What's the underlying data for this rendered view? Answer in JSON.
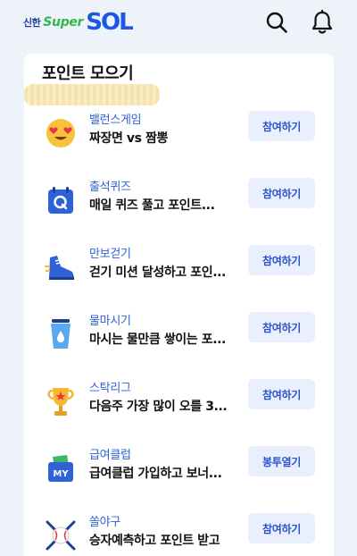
{
  "header": {
    "logo_shinhan": "신한",
    "logo_super": "Super",
    "logo_sol": "SOL",
    "search_icon": "search-icon",
    "bell_icon": "bell-icon"
  },
  "section": {
    "title": "포인트 모으기"
  },
  "items": [
    {
      "icon": "heart-eyes-emoji-icon",
      "category": "밸런스게임",
      "description": "짜장면 vs 짬뽕",
      "button": "참여하기"
    },
    {
      "icon": "calendar-quiz-icon",
      "category": "출석퀴즈",
      "description": "매일 퀴즈 풀고 포인트...",
      "button": "참여하기"
    },
    {
      "icon": "sneaker-icon",
      "category": "만보걷기",
      "description": "걷기 미션 달성하고 포인...",
      "button": "참여하기"
    },
    {
      "icon": "water-cup-icon",
      "category": "물마시기",
      "description": "마시는 물만큼 쌓이는 포...",
      "button": "참여하기"
    },
    {
      "icon": "trophy-icon",
      "category": "스탁리그",
      "description": "다음주 가장 많이 오를 3...",
      "button": "참여하기"
    },
    {
      "icon": "wallet-my-icon",
      "category": "급여클럽",
      "description": "급여클럽 가입하고 보너...",
      "button": "봉투열기"
    },
    {
      "icon": "baseball-icon",
      "category": "쏠야구",
      "description": "승자예측하고 포인트 받고",
      "button": "참여하기"
    }
  ],
  "colors": {
    "background": "#eef2f9",
    "accent_blue": "#2f62d7",
    "button_bg": "#e9effd",
    "logo_green": "#30b84a"
  }
}
